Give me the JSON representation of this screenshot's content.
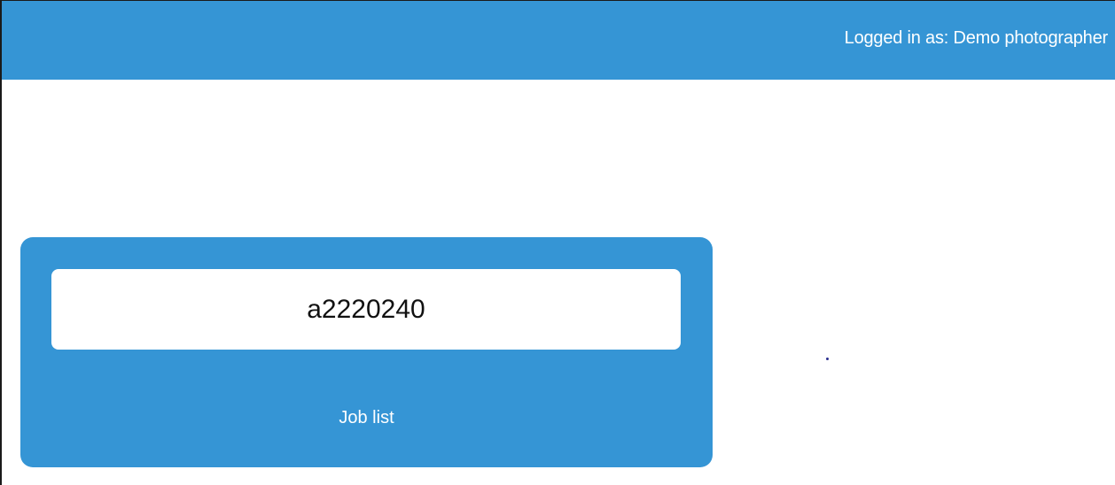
{
  "header": {
    "logged_in_text": "Logged in as: Demo photographer"
  },
  "job_card": {
    "job_number_value": "a2220240",
    "job_list_label": "Job list"
  },
  "colors": {
    "brand_blue": "#3595d5",
    "card_input_bg": "#ffffff",
    "text_light": "#ffffff"
  }
}
